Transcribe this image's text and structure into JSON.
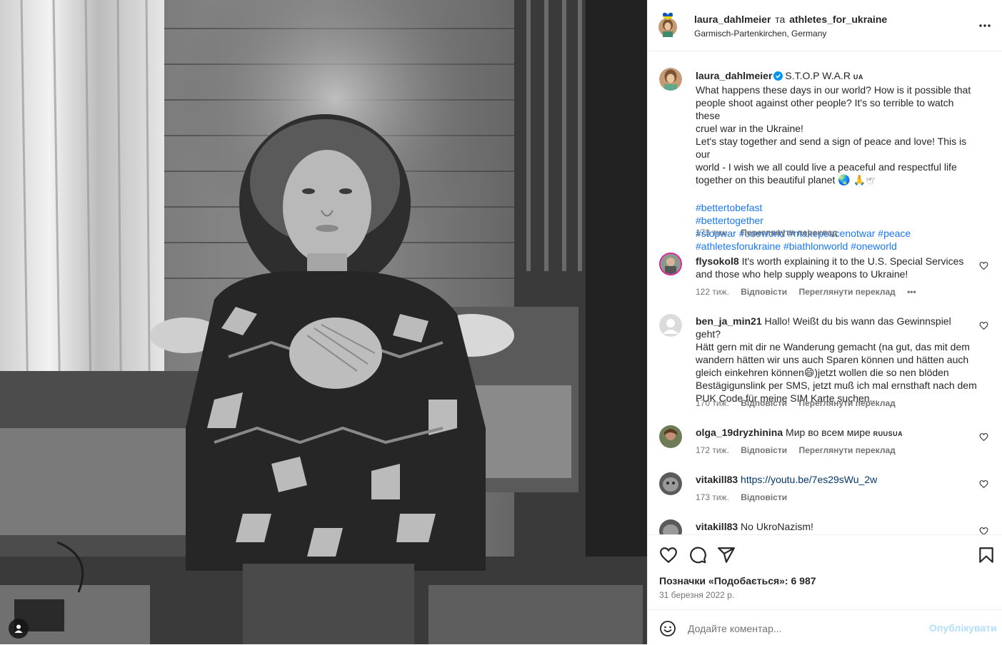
{
  "photo": {
    "description_icon": "tag-user-icon"
  },
  "header": {
    "author": "laura_dahlmeier",
    "and_word": "та",
    "collaborator": "athletes_for_ukraine",
    "location": "Garmisch-Partenkirchen, Germany",
    "more_icon": "more-horizontal-icon"
  },
  "caption": {
    "username": "laura_dahlmeier",
    "title": "S.T.O.P W.A.R",
    "flag": "UA",
    "lines": [
      "What happens these days in our world? How is it possible that",
      "people shoot against other people? It's so terrible to watch these",
      "cruel war in the Ukraine!",
      "Let's stay together and send a sign of peace and love! This is our",
      "world - I wish we all could live a peaceful and respectful life",
      "together on this beautiful planet"
    ],
    "hashtags": [
      [
        "#bettertobefast"
      ],
      [
        "#bettertogether"
      ],
      [
        "#stopwar",
        "#oneworld",
        "#makepeacenotwar",
        "#peace"
      ],
      [
        "#athletesforukraine",
        "#biathlonworld",
        "#oneworld"
      ]
    ],
    "time": "173 тиж.",
    "translate": "Переглянути переклад"
  },
  "comments": [
    {
      "username": "flysokol8",
      "text_lines": [
        "It's worth explaining it to the U.S. Special Services",
        "and those who help supply weapons to Ukraine!"
      ],
      "time": "122 тиж.",
      "reply": "Відповісти",
      "translate": "Переглянути переклад",
      "more": "•••"
    },
    {
      "username": "ben_ja_min21",
      "text_lines": [
        "Hallo! Weißt du bis wann das Gewinnspiel geht?",
        "Hätt gern mit dir ne Wanderung gemacht (na gut, das mit dem",
        "wandern hätten wir uns auch Sparen können und hätten auch",
        "gleich einkehren können😄)jetzt wollen die so nen blöden",
        "Bestägigunslink per SMS, jetzt muß ich mal ernsthaft nach dem",
        "PUK Code für meine SIM Karte suchen..."
      ],
      "time": "170 тиж.",
      "reply": "Відповісти",
      "translate": "Переглянути переклад"
    },
    {
      "username": "olga_19dryzhinina",
      "text_lines": [
        "Мир во всем мире"
      ],
      "flags": "RUUSUA",
      "time": "172 тиж.",
      "reply": "Відповісти",
      "translate": "Переглянути переклад"
    },
    {
      "username": "vitakill83",
      "text_lines": [
        "https://youtu.be/7es29sWu_2w"
      ],
      "time": "173 тиж.",
      "reply": "Відповісти"
    },
    {
      "username": "vitakill83",
      "text_lines": [
        "No UkroNazism!"
      ]
    }
  ],
  "actions": {
    "like_icon": "heart-icon",
    "comment_icon": "comment-icon",
    "share_icon": "share-icon",
    "save_icon": "bookmark-icon",
    "likes_text": "Позначки «Подобається»: 6 987",
    "date": "31 березня 2022 р."
  },
  "comment_box": {
    "placeholder": "Додайте коментар...",
    "publish": "Опублікувати"
  }
}
